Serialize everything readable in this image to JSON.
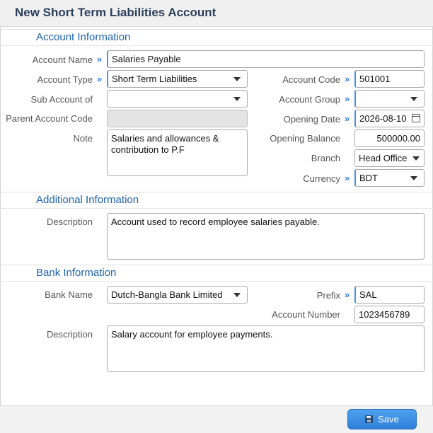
{
  "window": {
    "title": "New Short Term Liabilities Account"
  },
  "sections": {
    "account": "Account Information",
    "additional": "Additional Information",
    "bank": "Bank Information"
  },
  "account_info": {
    "account_name": {
      "label": "Account Name",
      "value": "Salaries Payable"
    },
    "account_type": {
      "label": "Account Type",
      "value": "Short Term Liabilities"
    },
    "sub_account_of": {
      "label": "Sub Account of",
      "value": ""
    },
    "parent_account_code": {
      "label": "Parent Account Code",
      "value": ""
    },
    "note": {
      "label": "Note",
      "value": "Salaries and allowances & contribution to P.F"
    },
    "account_code": {
      "label": "Account Code",
      "value": "501001"
    },
    "account_group": {
      "label": "Account Group",
      "value": ""
    },
    "opening_date": {
      "label": "Opening Date",
      "value": "2026-08-10"
    },
    "opening_balance": {
      "label": "Opening Balance",
      "value": "500000.00"
    },
    "branch": {
      "label": "Branch",
      "value": "Head Office"
    },
    "currency": {
      "label": "Currency",
      "value": "BDT"
    }
  },
  "additional_info": {
    "description": {
      "label": "Description",
      "value": "Account used to record employee salaries payable."
    }
  },
  "bank_info": {
    "bank_name": {
      "label": "Bank Name",
      "value": "Dutch-Bangla Bank Limited"
    },
    "prefix": {
      "label": "Prefix",
      "value": "SAL"
    },
    "account_number": {
      "label": "Account Number",
      "value": "1023456789"
    },
    "description": {
      "label": "Description",
      "value": "Salary account for employee payments."
    }
  },
  "footer": {
    "save_label": "Save"
  },
  "icons": {
    "required": "double-chevron-right-icon",
    "dropdown": "caret-down-icon",
    "calendar": "calendar-icon",
    "save": "floppy-disk-icon"
  },
  "colors": {
    "title": "#2b3f5c",
    "section": "#1f63b0",
    "required_marker": "#3c82d8",
    "save_button": "#2f7fd9"
  }
}
